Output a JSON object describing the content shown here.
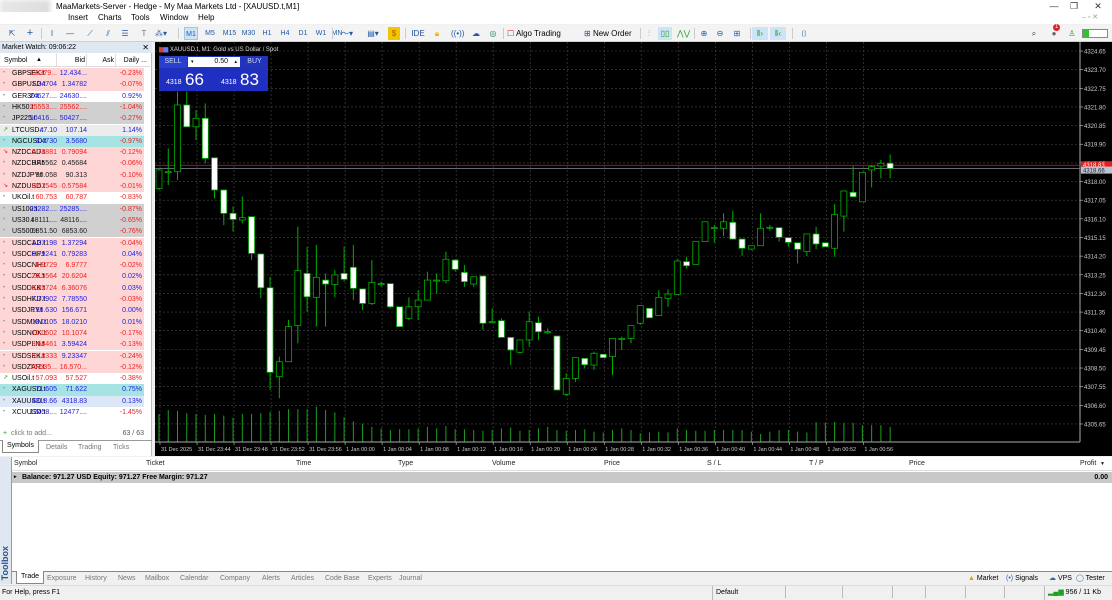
{
  "window": {
    "title": "MaaMarkets-Server - Hedge - My Maa Markets Ltd - [XAUUSD.t,M1]",
    "minimize": "—",
    "restore": "❐",
    "close": "✕"
  },
  "menu": [
    "Insert",
    "Charts",
    "Tools",
    "Window",
    "Help"
  ],
  "toolbar": {
    "drawing_tools": [
      "cursor-icon",
      "crosshair-icon",
      "vertical-line-icon",
      "horizontal-line-icon",
      "trendline-icon",
      "channel-icon",
      "fibonacci-icon",
      "text-icon",
      "shapes-icon"
    ],
    "timeframes": [
      "M1",
      "M5",
      "M15",
      "M30",
      "H1",
      "H4",
      "D1",
      "W1",
      "MN"
    ],
    "active_timeframe": "M1",
    "ide": "IDE",
    "algo_trading": "Algo Trading",
    "new_order": "New Order",
    "notification_count": "1"
  },
  "market_watch": {
    "title": "Market Watch: 09:06:22",
    "columns": [
      "Symbol",
      "Bid",
      "Ask",
      "Daily ..."
    ],
    "rows": [
      {
        "symbol": "GBPSEK.t",
        "bid": "12.379...",
        "ask": "12.434...",
        "change": "-0.23%",
        "bg": "pink",
        "bid_dir": "down",
        "ask_dir": "up",
        "chg_dir": "down",
        "icon": "dot"
      },
      {
        "symbol": "GBPUSD.t",
        "bid": "1.34704",
        "ask": "1.34782",
        "change": "-0.07%",
        "bg": "pink",
        "bid_dir": "up",
        "ask_dir": "up",
        "chg_dir": "down",
        "icon": "dot"
      },
      {
        "symbol": "GER30.t",
        "bid": "24627....",
        "ask": "24630....",
        "change": "0.92%",
        "bg": "white",
        "bid_dir": "up",
        "ask_dir": "up",
        "chg_dir": "up",
        "icon": "dot"
      },
      {
        "symbol": "HK50.t",
        "bid": "25553....",
        "ask": "25562....",
        "change": "-1.04%",
        "bg": "gray",
        "bid_dir": "down",
        "ask_dir": "down",
        "chg_dir": "down",
        "icon": "dot"
      },
      {
        "symbol": "JP225.t",
        "bid": "50416....",
        "ask": "50427....",
        "change": "-0.27%",
        "bg": "gray",
        "bid_dir": "up",
        "ask_dir": "up",
        "chg_dir": "down",
        "icon": "dot"
      },
      {
        "symbol": "LTCUSD.t",
        "bid": "47.10",
        "ask": "107.14",
        "change": "1.14%",
        "bg": "light",
        "bid_dir": "up",
        "ask_dir": "up",
        "chg_dir": "up",
        "icon": "arrow-up"
      },
      {
        "symbol": "NGCUSD.t",
        "bid": "3.4730",
        "ask": "3.5680",
        "change": "-0.97%",
        "bg": "cyan",
        "bid_dir": "up",
        "ask_dir": "up",
        "chg_dir": "down",
        "icon": "dot"
      },
      {
        "symbol": "NZDCAD.t",
        "bid": "0.78881",
        "ask": "0.79094",
        "change": "-0.12%",
        "bg": "pink",
        "bid_dir": "down",
        "ask_dir": "down",
        "chg_dir": "down",
        "icon": "arrow-down"
      },
      {
        "symbol": "NZDCHF.t",
        "bid": "0.45562",
        "ask": "0.45684",
        "change": "-0.06%",
        "bg": "pink",
        "bid_dir": "neutral",
        "ask_dir": "neutral",
        "chg_dir": "down",
        "icon": "dot"
      },
      {
        "symbol": "NZDJPY.t",
        "bid": "90.058",
        "ask": "90.313",
        "change": "-0.10%",
        "bg": "pink",
        "bid_dir": "neutral",
        "ask_dir": "neutral",
        "chg_dir": "down",
        "icon": "dot"
      },
      {
        "symbol": "NZDUSD.t",
        "bid": "0.57545",
        "ask": "0.57584",
        "change": "-0.01%",
        "bg": "pink",
        "bid_dir": "down",
        "ask_dir": "down",
        "chg_dir": "down",
        "icon": "arrow-down"
      },
      {
        "symbol": "UKOil.t",
        "bid": "60.753",
        "ask": "60.787",
        "change": "-0.83%",
        "bg": "white",
        "bid_dir": "down",
        "ask_dir": "down",
        "chg_dir": "down",
        "icon": "dot"
      },
      {
        "symbol": "US100.t",
        "bid": "25282....",
        "ask": "25285....",
        "change": "-0.87%",
        "bg": "gray",
        "bid_dir": "up",
        "ask_dir": "up",
        "chg_dir": "down",
        "icon": "dot"
      },
      {
        "symbol": "US30.t",
        "bid": "48111....",
        "ask": "48116....",
        "change": "-0.65%",
        "bg": "gray",
        "bid_dir": "neutral",
        "ask_dir": "neutral",
        "chg_dir": "down",
        "icon": "dot"
      },
      {
        "symbol": "US500.t",
        "bid": "6851.50",
        "ask": "6853.60",
        "change": "-0.76%",
        "bg": "gray",
        "bid_dir": "neutral",
        "ask_dir": "neutral",
        "chg_dir": "down",
        "icon": "dot"
      },
      {
        "symbol": "USDCAD.t",
        "bid": "1.37198",
        "ask": "1.37294",
        "change": "-0.04%",
        "bg": "pink",
        "bid_dir": "up",
        "ask_dir": "up",
        "chg_dir": "down",
        "icon": "dot"
      },
      {
        "symbol": "USDCHF.t",
        "bid": "0.79241",
        "ask": "0.79283",
        "change": "0.04%",
        "bg": "pink",
        "bid_dir": "up",
        "ask_dir": "up",
        "chg_dir": "up",
        "icon": "dot"
      },
      {
        "symbol": "USDCNH.t",
        "bid": "6.9729",
        "ask": "6.9777",
        "change": "-0.02%",
        "bg": "pink",
        "bid_dir": "down",
        "ask_dir": "down",
        "chg_dir": "down",
        "icon": "dot"
      },
      {
        "symbol": "USDCZK.t",
        "bid": "20.5564",
        "ask": "20.6204",
        "change": "0.02%",
        "bg": "pink",
        "bid_dir": "down",
        "ask_dir": "down",
        "chg_dir": "up",
        "icon": "dot"
      },
      {
        "symbol": "USDDKK.t",
        "bid": "6.35724",
        "ask": "6.36076",
        "change": "0.03%",
        "bg": "pink",
        "bid_dir": "down",
        "ask_dir": "down",
        "chg_dir": "up",
        "icon": "dot"
      },
      {
        "symbol": "USDHKD.t",
        "bid": "7.77902",
        "ask": "7.78550",
        "change": "-0.03%",
        "bg": "pink",
        "bid_dir": "up",
        "ask_dir": "up",
        "chg_dir": "down",
        "icon": "dot"
      },
      {
        "symbol": "USDJPY.t",
        "bid": "156.630",
        "ask": "156.671",
        "change": "0.00%",
        "bg": "pink",
        "bid_dir": "up",
        "ask_dir": "up",
        "chg_dir": "up",
        "icon": "dot"
      },
      {
        "symbol": "USDMXN.t",
        "bid": "18.0105",
        "ask": "18.0210",
        "change": "0.01%",
        "bg": "pink",
        "bid_dir": "up",
        "ask_dir": "up",
        "chg_dir": "up",
        "icon": "dot"
      },
      {
        "symbol": "USDNOK.t",
        "bid": "10.0602",
        "ask": "10.1074",
        "change": "-0.17%",
        "bg": "pink",
        "bid_dir": "down",
        "ask_dir": "down",
        "chg_dir": "down",
        "icon": "dot"
      },
      {
        "symbol": "USDPLN.t",
        "bid": "3.58461",
        "ask": "3.59424",
        "change": "-0.13%",
        "bg": "pink",
        "bid_dir": "down",
        "ask_dir": "up",
        "chg_dir": "down",
        "icon": "dot"
      },
      {
        "symbol": "USDSEK.t",
        "bid": "9.18333",
        "ask": "9.23347",
        "change": "-0.24%",
        "bg": "pink",
        "bid_dir": "down",
        "ask_dir": "up",
        "chg_dir": "down",
        "icon": "dot"
      },
      {
        "symbol": "USDZAR.t",
        "bid": "16.535...",
        "ask": "16.570...",
        "change": "-0.12%",
        "bg": "pink",
        "bid_dir": "down",
        "ask_dir": "down",
        "chg_dir": "down",
        "icon": "dot"
      },
      {
        "symbol": "USOil.t",
        "bid": "57.093",
        "ask": "57.527",
        "change": "-0.38%",
        "bg": "white",
        "bid_dir": "down",
        "ask_dir": "down",
        "chg_dir": "down",
        "icon": "arrow-up"
      },
      {
        "symbol": "XAGUSD.t",
        "bid": "71.605",
        "ask": "71.622",
        "change": "0.75%",
        "bg": "cyan",
        "bid_dir": "up",
        "ask_dir": "up",
        "chg_dir": "up",
        "icon": "dot"
      },
      {
        "symbol": "XAUUSD.t",
        "bid": "4318.66",
        "ask": "4318.83",
        "change": "0.13%",
        "bg": "selected",
        "bid_dir": "up",
        "ask_dir": "up",
        "chg_dir": "up",
        "icon": "dot"
      },
      {
        "symbol": "XCUUSD.t",
        "bid": "12458....",
        "ask": "12477....",
        "change": "-1.45%",
        "bg": "white",
        "bid_dir": "up",
        "ask_dir": "up",
        "chg_dir": "down",
        "icon": "dot"
      }
    ],
    "add_placeholder": "click to add...",
    "count": "63 / 63",
    "tabs": [
      "Symbols",
      "Details",
      "Trading",
      "Ticks"
    ],
    "active_tab": "Symbols"
  },
  "colors": {
    "up": "#2020e0",
    "down": "#f02020",
    "pink": "#ffd6d6",
    "gray": "#d0d0d0",
    "cyan": "#a6e3e3",
    "selected": "#dce8f7",
    "light": "#ececec",
    "white": "#ffffff",
    "bull": "#00c000",
    "bear": "#ffffff",
    "grid": "#4a4a4a",
    "ask_line": "#d02020"
  },
  "chart": {
    "title": "XAUUSD.t, M1:  Gold vs US Dollar / Spot",
    "one_click": {
      "sell": "SELL",
      "buy": "BUY",
      "volume": "0.50",
      "sell_big": "4318",
      "sell_pips": "66",
      "buy_big": "4318",
      "buy_pips": "83"
    },
    "ask_label": "4318.83",
    "bid_label": "4318.66"
  },
  "chart_data": {
    "type": "candlestick",
    "symbol": "XAUUSD.t",
    "timeframe": "M1",
    "ylim": [
      4304.9,
      4325.1
    ],
    "y_ticks": [
      "4324.65",
      "4323.70",
      "4322.75",
      "4321.80",
      "4320.85",
      "4319.90",
      "4318.95",
      "4318.00",
      "4317.05",
      "4316.10",
      "4315.15",
      "4314.20",
      "4313.25",
      "4312.30",
      "4311.35",
      "4310.40",
      "4309.45",
      "4308.50",
      "4307.55",
      "4306.60",
      "4305.65"
    ],
    "x_ticks": [
      "31 Dec 2025",
      "31 Dec 23:44",
      "31 Dec 23:48",
      "31 Dec 23:52",
      "31 Dec 23:56",
      "1 Jan 00:00",
      "1 Jan 00:04",
      "1 Jan 00:08",
      "1 Jan 00:12",
      "1 Jan 00:16",
      "1 Jan 00:20",
      "1 Jan 00:24",
      "1 Jan 00:28",
      "1 Jan 00:32",
      "1 Jan 00:36",
      "1 Jan 00:40",
      "1 Jan 00:44",
      "1 Jan 00:48",
      "1 Jan 00:52",
      "1 Jan 00:56"
    ],
    "grid": true,
    "ohlc": [
      [
        4317.65,
        4318.67,
        4317.57,
        4318.59
      ],
      [
        4318.5,
        4319.69,
        4317.82,
        4318.5
      ],
      [
        4318.5,
        4322.58,
        4318.08,
        4321.9
      ],
      [
        4321.9,
        4322.58,
        4320.79,
        4320.79
      ],
      [
        4320.79,
        4321.64,
        4320.11,
        4321.22
      ],
      [
        4321.22,
        4321.98,
        4318.93,
        4319.18
      ],
      [
        4319.21,
        4319.21,
        4317.14,
        4317.57
      ],
      [
        4317.57,
        4317.57,
        4315.78,
        4316.38
      ],
      [
        4316.38,
        4316.72,
        4315.45,
        4316.07
      ],
      [
        4316.04,
        4317.23,
        4315.87,
        4316.16
      ],
      [
        4316.21,
        4316.21,
        4314.0,
        4314.34
      ],
      [
        4314.31,
        4314.31,
        4312.05,
        4312.59
      ],
      [
        4312.59,
        4313.15,
        4307.38,
        4308.28
      ],
      [
        4308.06,
        4309.08,
        4306.96,
        4308.82
      ],
      [
        4308.82,
        4310.95,
        4308.82,
        4310.61
      ],
      [
        4310.66,
        4315.7,
        4309.76,
        4313.46
      ],
      [
        4313.32,
        4314.68,
        4311.37,
        4312.13
      ],
      [
        4312.1,
        4314.77,
        4310.61,
        4313.12
      ],
      [
        4312.98,
        4313.32,
        4310.61,
        4312.78
      ],
      [
        4312.76,
        4313.49,
        4312.1,
        4313.24
      ],
      [
        4313.32,
        4314.68,
        4312.9,
        4313.02
      ],
      [
        4313.63,
        4314.77,
        4311.96,
        4312.56
      ],
      [
        4312.53,
        4312.53,
        4311.45,
        4311.79
      ],
      [
        4311.79,
        4314.0,
        4311.71,
        4312.86
      ],
      [
        4312.8,
        4312.9,
        4312.64,
        4312.8
      ],
      [
        4312.8,
        4312.8,
        4311.54,
        4311.62
      ],
      [
        4311.62,
        4311.62,
        4310.61,
        4310.61
      ],
      [
        4311.03,
        4312.1,
        4310.95,
        4311.62
      ],
      [
        4311.62,
        4312.47,
        4310.95,
        4311.96
      ],
      [
        4311.96,
        4313.41,
        4311.96,
        4312.98
      ],
      [
        4312.98,
        4313.32,
        4312.3,
        4312.98
      ],
      [
        4312.95,
        4314.43,
        4312.81,
        4314.04
      ],
      [
        4314.0,
        4314.04,
        4313.41,
        4313.53
      ],
      [
        4313.37,
        4313.75,
        4312.64,
        4312.9
      ],
      [
        4312.78,
        4313.15,
        4312.64,
        4313.15
      ],
      [
        4313.19,
        4313.19,
        4310.44,
        4310.78
      ],
      [
        4310.86,
        4311.54,
        4310.78,
        4310.86
      ],
      [
        4310.91,
        4311.03,
        4310.06,
        4310.06
      ],
      [
        4310.06,
        4310.06,
        4308.65,
        4309.42
      ],
      [
        4309.3,
        4309.93,
        4309.25,
        4309.93
      ],
      [
        4309.93,
        4311.37,
        4309.59,
        4310.86
      ],
      [
        4310.81,
        4311.12,
        4309.93,
        4310.35
      ],
      [
        4310.35,
        4310.52,
        4310.23,
        4310.35
      ],
      [
        4310.13,
        4310.13,
        4307.38,
        4307.38
      ],
      [
        4307.16,
        4308.23,
        4307.07,
        4307.97
      ],
      [
        4307.97,
        4309.03,
        4307.8,
        4309.03
      ],
      [
        4308.99,
        4308.99,
        4308.48,
        4308.67
      ],
      [
        4308.65,
        4309.33,
        4308.4,
        4309.25
      ],
      [
        4309.2,
        4309.2,
        4309.03,
        4309.03
      ],
      [
        4309.08,
        4310.01,
        4308.14,
        4310.01
      ],
      [
        4310.01,
        4310.1,
        4309.42,
        4310.01
      ],
      [
        4310.01,
        4310.66,
        4309.76,
        4310.66
      ],
      [
        4310.78,
        4311.68,
        4310.69,
        4311.68
      ],
      [
        4311.54,
        4311.54,
        4311.06,
        4311.06
      ],
      [
        4311.17,
        4312.47,
        4311.17,
        4312.1
      ],
      [
        4312.05,
        4312.51,
        4311.62,
        4312.27
      ],
      [
        4312.25,
        4314.04,
        4312.25,
        4313.95
      ],
      [
        4313.92,
        4314.17,
        4313.58,
        4313.71
      ],
      [
        4313.78,
        4314.94,
        4313.78,
        4314.94
      ],
      [
        4314.94,
        4315.95,
        4314.94,
        4315.95
      ],
      [
        4315.65,
        4315.78,
        4314.88,
        4315.65
      ],
      [
        4315.62,
        4316.38,
        4315.22,
        4315.95
      ],
      [
        4315.92,
        4316.52,
        4315.07,
        4315.07
      ],
      [
        4315.07,
        4315.07,
        4314.21,
        4314.6
      ],
      [
        4314.56,
        4314.73,
        4314.51,
        4314.73
      ],
      [
        4314.73,
        4316.38,
        4314.73,
        4315.62
      ],
      [
        4315.67,
        4315.78,
        4315.5,
        4315.67
      ],
      [
        4315.65,
        4315.65,
        4314.94,
        4315.16
      ],
      [
        4315.14,
        4315.14,
        4314.68,
        4314.9
      ],
      [
        4314.88,
        4314.88,
        4313.83,
        4314.55
      ],
      [
        4314.43,
        4315.33,
        4314.21,
        4315.33
      ],
      [
        4315.33,
        4315.7,
        4314.55,
        4314.82
      ],
      [
        4314.88,
        4314.88,
        4314.68,
        4314.68
      ],
      [
        4314.6,
        4316.85,
        4314.17,
        4316.33
      ],
      [
        4316.24,
        4317.52,
        4315.45,
        4317.52
      ],
      [
        4317.45,
        4318.79,
        4317.23,
        4317.23
      ],
      [
        4316.97,
        4318.47,
        4316.97,
        4318.47
      ],
      [
        4318.59,
        4318.84,
        4317.7,
        4318.76
      ],
      [
        4318.79,
        4319.1,
        4318.16,
        4318.93
      ],
      [
        4318.93,
        4319.38,
        4318.16,
        4318.67
      ]
    ],
    "volume_relative": [
      70,
      80,
      78,
      72,
      70,
      68,
      70,
      66,
      60,
      70,
      70,
      72,
      75,
      78,
      82,
      82,
      82,
      88,
      80,
      74,
      62,
      52,
      46,
      38,
      34,
      30,
      32,
      32,
      34,
      38,
      34,
      40,
      32,
      32,
      30,
      28,
      30,
      34,
      36,
      28,
      30,
      34,
      38,
      30,
      28,
      30,
      32,
      26,
      24,
      30,
      34,
      30,
      22,
      24,
      26,
      24,
      34,
      30,
      28,
      28,
      30,
      30,
      30,
      30,
      26,
      20,
      26,
      30,
      30,
      26,
      24,
      50,
      48,
      50,
      48,
      48,
      42,
      42,
      42,
      38
    ]
  },
  "trade": {
    "columns": [
      "Symbol",
      "Ticket",
      "Time",
      "Type",
      "Volume",
      "Price",
      "S / L",
      "T / P",
      "Price",
      "Profit"
    ],
    "balance_line": "Balance: 971.27 USD  Equity: 971.27  Free Margin: 971.27",
    "profit_total": "0.00",
    "toolbox_label": "Toolbox",
    "tabs": [
      "Trade",
      "Exposure",
      "History",
      "News",
      "Mailbox",
      "Calendar",
      "Company",
      "Alerts",
      "Articles",
      "Code Base",
      "Experts",
      "Journal"
    ],
    "active_tab": "Trade",
    "links": [
      "Market",
      "Signals",
      "VPS",
      "Tester"
    ]
  },
  "status": {
    "help": "For Help, press F1",
    "profile": "Default",
    "traffic": "956 / 11 Kb"
  }
}
